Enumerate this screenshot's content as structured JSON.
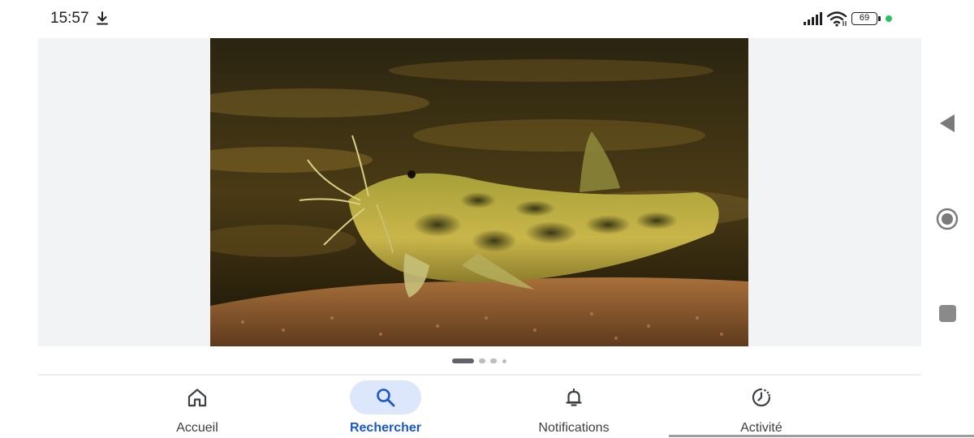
{
  "status_bar": {
    "time": "15:57",
    "battery_level": "69",
    "icons": [
      "download-icon",
      "signal-icon",
      "wifi-icon",
      "battery-icon",
      "dot-indicator"
    ],
    "dot_color": "#22c55e"
  },
  "carousel": {
    "image_subject": "spotted yellow-green catfish with long barbels resting on sandy gravel",
    "page_count": 4,
    "active_page": 1
  },
  "nav": {
    "items": [
      {
        "label": "Accueil",
        "icon": "home-icon",
        "active": false
      },
      {
        "label": "Rechercher",
        "icon": "search-icon",
        "active": true
      },
      {
        "label": "Notifications",
        "icon": "bell-icon",
        "active": false
      },
      {
        "label": "Activité",
        "icon": "activity-icon",
        "active": false
      }
    ]
  },
  "system_nav": {
    "icons": [
      "back-icon",
      "home-circle-icon",
      "recents-icon"
    ]
  },
  "colors": {
    "accent": "#1a57c9",
    "active_pill": "#dde7fb",
    "panel_bg": "#f1f3f4"
  }
}
